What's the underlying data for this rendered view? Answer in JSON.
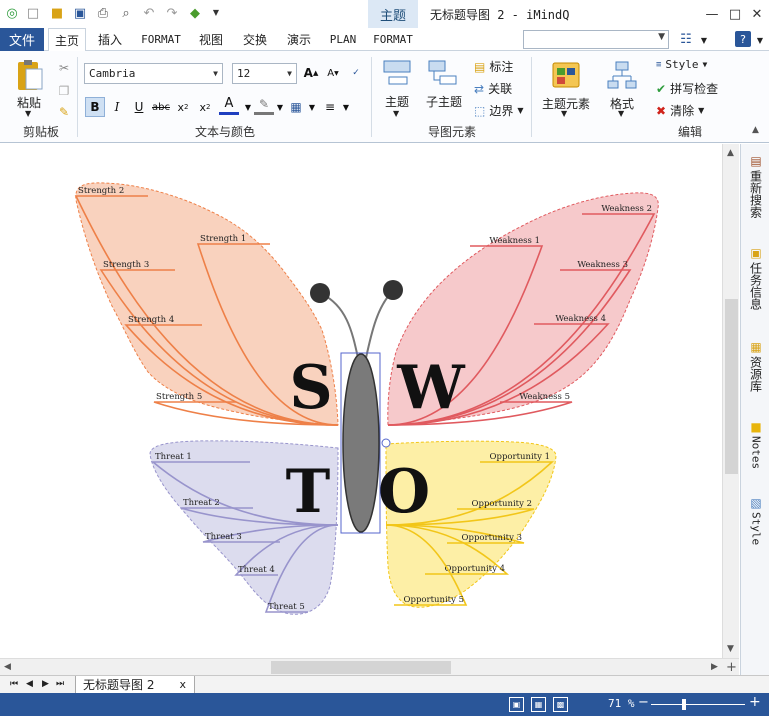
{
  "window": {
    "context_tab": "主题",
    "title": "无标题导图 2 - iMindQ"
  },
  "menubar": {
    "file": "文件",
    "tabs": [
      "主页",
      "插入",
      "FORMAT",
      "视图",
      "交换",
      "演示",
      "PLAN",
      "FORMAT"
    ],
    "active_tab": 0
  },
  "ribbon": {
    "clipboard": {
      "paste": "粘贴",
      "group_label": "剪贴板"
    },
    "font": {
      "family": "Cambria",
      "size": "12",
      "group_label": "文本与颜色"
    },
    "elements": {
      "topic": "主题",
      "subtopic": "子主题",
      "callout": "标注",
      "relationship": "关联",
      "boundary": "边界",
      "group_label": "导图元素"
    },
    "edit": {
      "topic_elements": "主题元素",
      "format": "格式",
      "style": "Style",
      "spell_check": "拼写检查",
      "clear": "清除",
      "group_label": "编辑"
    }
  },
  "mindmap": {
    "letters": {
      "s": "S",
      "w": "W",
      "t": "T",
      "o": "O"
    },
    "strengths": [
      "Strength 1",
      "Strength 2",
      "Strength 3",
      "Strength 4",
      "Strength 5"
    ],
    "weaknesses": [
      "Weakness 1",
      "Weakness 2",
      "Weakness 3",
      "Weakness 4",
      "Weakness 5"
    ],
    "threats": [
      "Threat 1",
      "Threat 2",
      "Threat 3",
      "Threat 4",
      "Threat 5"
    ],
    "opportunities": [
      "Opportunity 1",
      "Opportunity 2",
      "Opportunity 3",
      "Opportunity 4",
      "Opportunity 5"
    ],
    "colors": {
      "strength_fill": "#f9d2be",
      "strength_line": "#ee8048",
      "weakness_fill": "#f6c9cb",
      "weakness_line": "#e05a5f",
      "threat_fill": "#dcdcee",
      "threat_line": "#9894cc",
      "opportunity_fill": "#fdefa6",
      "opportunity_line": "#f2c619"
    }
  },
  "side_panel": [
    "重新搜索",
    "任务信息",
    "资源库",
    "Notes",
    "Style"
  ],
  "tabs": {
    "document": "无标题导图 2",
    "close": "x"
  },
  "status": {
    "zoom": "71 %",
    "zoom_fraction": 0.35
  }
}
